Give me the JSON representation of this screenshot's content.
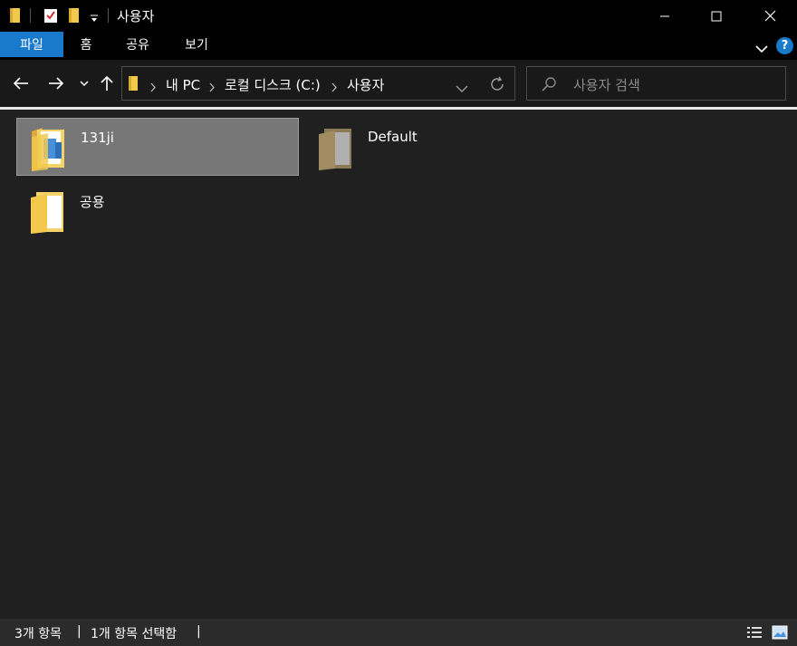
{
  "window": {
    "title": "사용자"
  },
  "ribbon": {
    "tabs": [
      "파일",
      "홈",
      "공유",
      "보기"
    ],
    "help_label": "?"
  },
  "nav": {
    "breadcrumbs": [
      "내 PC",
      "로컬 디스크 (C:)",
      "사용자"
    ],
    "search_placeholder": "사용자 검색"
  },
  "items": [
    {
      "name": "131ji",
      "selected": true
    },
    {
      "name": "Default",
      "selected": false
    },
    {
      "name": "공용",
      "selected": false
    }
  ],
  "status": {
    "item_count": "3개 항목",
    "selected_count": "1개 항목 선택함"
  },
  "colors": {
    "accent": "#1979ca",
    "selection": "#777777",
    "folder": "#f2c94c"
  }
}
